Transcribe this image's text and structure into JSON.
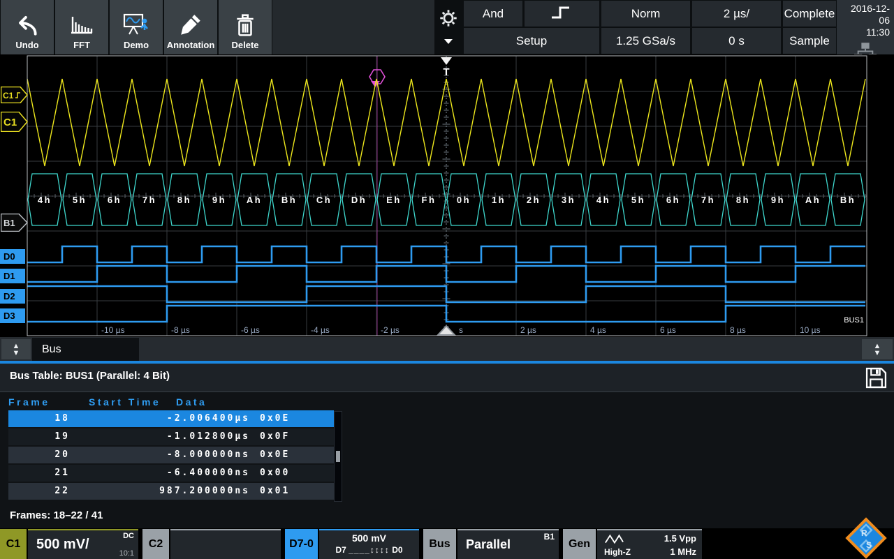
{
  "topbar": {
    "buttons": [
      {
        "label": "Undo",
        "icon": "undo-icon"
      },
      {
        "label": "FFT",
        "icon": "fft-icon"
      },
      {
        "label": "Demo",
        "icon": "demo-icon"
      },
      {
        "label": "Annotation",
        "icon": "annotation-icon"
      },
      {
        "label": "Delete",
        "icon": "delete-icon"
      }
    ],
    "status": {
      "trigger_logic": "And",
      "trigger_setup": "Setup",
      "trigger_mode": "Norm",
      "sample_rate": "1.25 GSa/s",
      "timebase": "2 µs/",
      "horizontal_position": "0 s",
      "acquisition_status": "Complete",
      "acquisition_mode": "Sample",
      "date": "2016-12-06",
      "time": "11:30"
    }
  },
  "scope": {
    "trigger_channel_tag": "C1",
    "channel_tag": "C1",
    "bus_position_tag": "B1",
    "digital_tags": [
      "D0",
      "D1",
      "D2",
      "D3"
    ],
    "bus_name_label": "BUS1",
    "trigger_marker": "T",
    "time_axis_labels": [
      "-10 µs",
      "-8 µs",
      "-6 µs",
      "-4 µs",
      "-2 µs",
      "s",
      "2 µs",
      "4 µs",
      "6 µs",
      "8 µs",
      "10 µs"
    ],
    "bus_values": [
      "4h",
      "5h",
      "6h",
      "7h",
      "8h",
      "9h",
      "Ah",
      "Bh",
      "Ch",
      "Dh",
      "Eh",
      "Fh",
      "0h",
      "1h",
      "2h",
      "3h",
      "4h",
      "5h",
      "6h",
      "7h",
      "8h",
      "9h",
      "Ah",
      "Bh"
    ],
    "counter_values": [
      4,
      5,
      6,
      7,
      8,
      9,
      10,
      11,
      12,
      13,
      14,
      15,
      0,
      1,
      2,
      3,
      4,
      5,
      6,
      7,
      8,
      9,
      10,
      11
    ]
  },
  "tab_bar": {
    "active_tab": "Bus"
  },
  "bus_table": {
    "title": "Bus Table: BUS1 (Parallel: 4 Bit)",
    "columns": [
      "Frame",
      "Start Time",
      "Data"
    ],
    "rows": [
      {
        "frame": "18",
        "start": "-2.006400µs",
        "data": "0x0E",
        "selected": true
      },
      {
        "frame": "19",
        "start": "-1.012800µs",
        "data": "0x0F",
        "selected": false
      },
      {
        "frame": "20",
        "start": "-8.000000ns",
        "data": "0x0E",
        "selected": false
      },
      {
        "frame": "21",
        "start": "-6.400000ns",
        "data": "0x00",
        "selected": false
      },
      {
        "frame": "22",
        "start": "987.200000ns",
        "data": "0x01",
        "selected": false
      }
    ],
    "footer": "Frames: 18–22 / 41"
  },
  "status_bar": {
    "c1": {
      "tag": "C1",
      "scale": "500 mV/",
      "coupling": "DC",
      "probe": "10:1"
    },
    "c2": {
      "tag": "C2"
    },
    "d70": {
      "tag": "D7-0",
      "scale": "500 mV",
      "bits_left": "D7",
      "bits_pattern": "____↕↕↕↕",
      "bits_right": "D0"
    },
    "bus": {
      "tag": "Bus",
      "type": "Parallel",
      "name": "B1"
    },
    "gen": {
      "tag": "Gen",
      "load": "High-Z",
      "amplitude": "1.5 Vpp",
      "frequency": "1 MHz"
    }
  },
  "icons": {
    "scroll_up": "▲",
    "scroll_down": "▼"
  },
  "colors": {
    "accent_blue": "#1b87e0",
    "channel_yellow": "#ede71c",
    "bus_cyan": "#3fd8ce",
    "digital_blue": "#2e9bf0",
    "c1_olive": "#8f9826",
    "gray_tag": "#9aa1a7",
    "magenta_marker": "#e050d8"
  }
}
